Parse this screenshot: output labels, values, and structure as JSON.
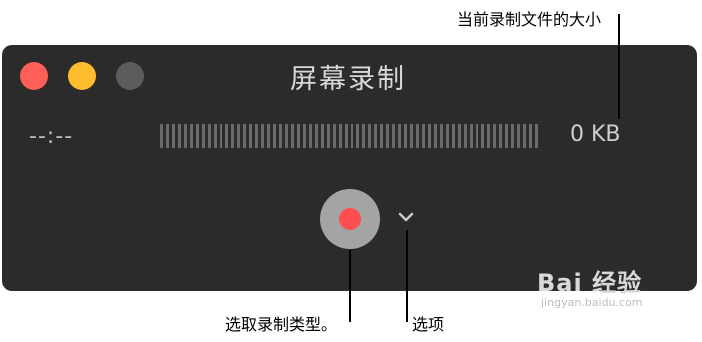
{
  "window": {
    "title": "屏幕录制",
    "time_readout": "--:--",
    "file_size": "0 KB",
    "level_meter_level": 0,
    "traffic_lights": {
      "close_color": "#fe5f57",
      "minimize_color": "#febc2e",
      "zoom_color": "#5c5c5c"
    }
  },
  "controls": {
    "record_button_icon": "record-icon",
    "options_icon": "chevron-down-icon"
  },
  "callouts": {
    "file_size": "当前录制文件的大小",
    "record_type": "选取录制类型。",
    "options": "选项"
  },
  "watermark": {
    "main": "Bai 经验",
    "sub": "jingyan.baidu.com"
  },
  "colors": {
    "window_background": "#2b2b2b",
    "record_dot": "#fe4e4f"
  }
}
